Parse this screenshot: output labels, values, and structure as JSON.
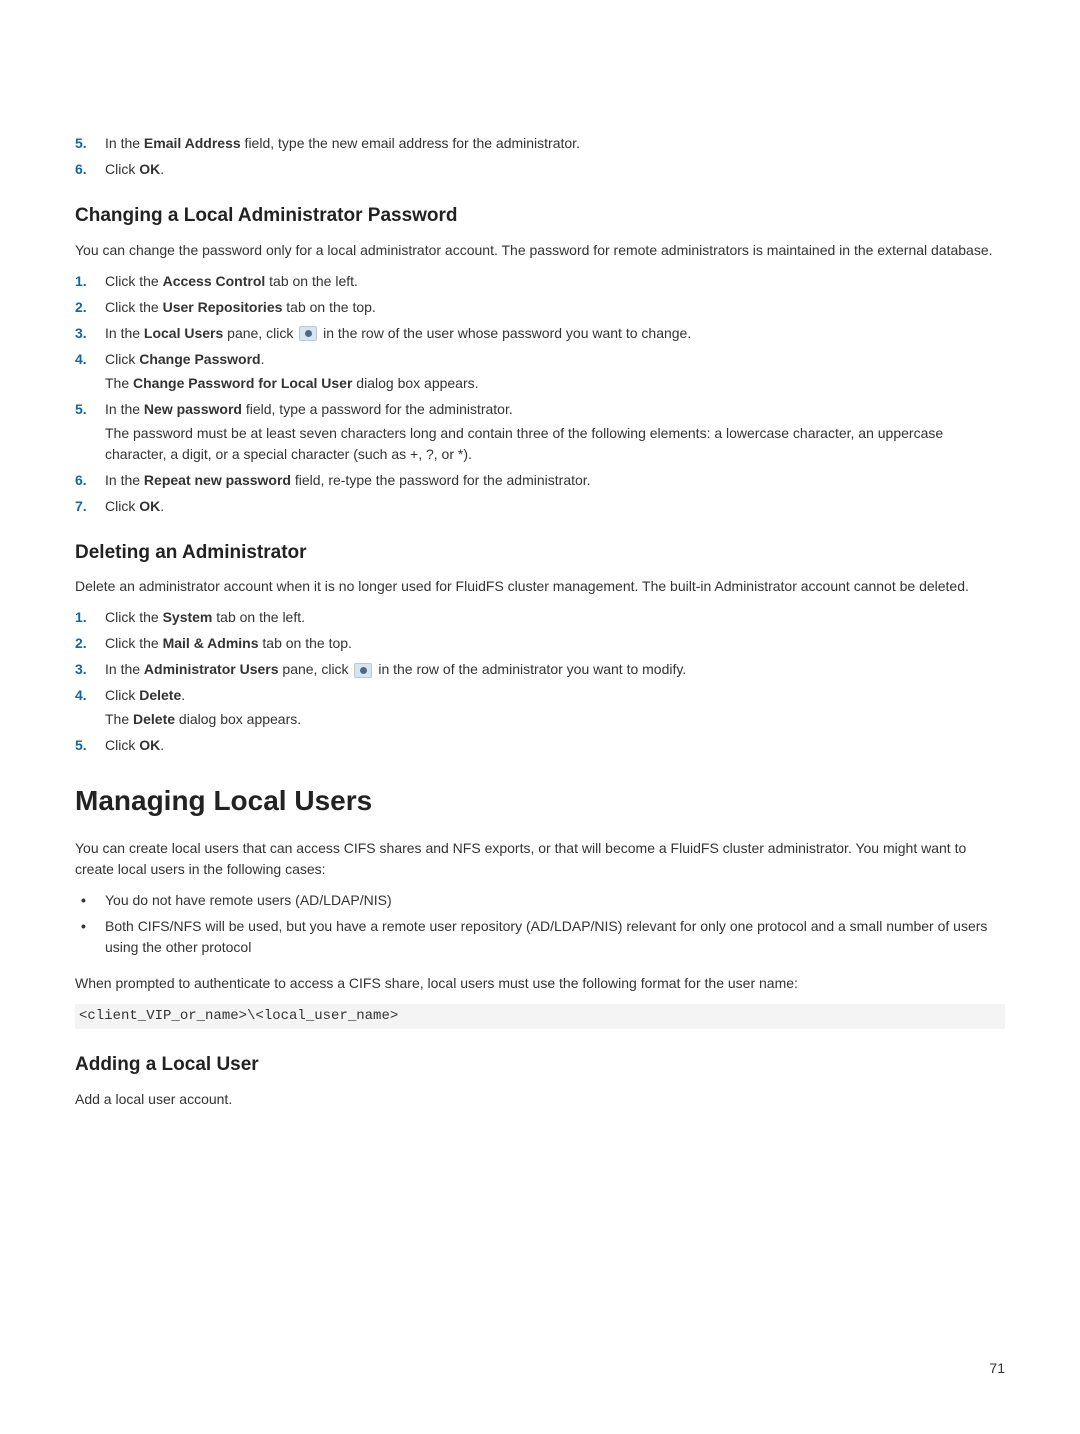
{
  "topSteps": {
    "s5": {
      "num": "5.",
      "pre": "In the ",
      "bold": "Email Address",
      "post": " field, type the new email address for the administrator."
    },
    "s6": {
      "num": "6.",
      "pre": "Click ",
      "bold": "OK",
      "post": "."
    }
  },
  "h_changing": "Changing a Local Administrator Password",
  "p_changing": "You can change the password only for a local administrator account. The password for remote administrators is maintained in the external database.",
  "chSteps": {
    "s1": {
      "num": "1.",
      "pre": "Click the ",
      "bold": "Access Control",
      "post": " tab on the left."
    },
    "s2": {
      "num": "2.",
      "pre": "Click the ",
      "bold": "User Repositories",
      "post": " tab on the top."
    },
    "s3": {
      "num": "3.",
      "pre": "In the ",
      "bold": "Local Users",
      "mid": " pane, click ",
      "post": " in the row of the user whose password you want to change."
    },
    "s4": {
      "num": "4.",
      "pre": "Click ",
      "bold": "Change Password",
      "post": ".",
      "sub_pre": "The ",
      "sub_bold": "Change Password for Local User",
      "sub_post": " dialog box appears."
    },
    "s5": {
      "num": "5.",
      "pre": "In the ",
      "bold": "New password",
      "post": " field, type a password for the administrator.",
      "sub": "The password must be at least seven characters long and contain three of the following elements: a lowercase character, an uppercase character, a digit, or a special character (such as +, ?, or *)."
    },
    "s6": {
      "num": "6.",
      "pre": "In the ",
      "bold": "Repeat new password",
      "post": " field, re‑type the password for the administrator."
    },
    "s7": {
      "num": "7.",
      "pre": "Click ",
      "bold": "OK",
      "post": "."
    }
  },
  "h_deleting": "Deleting an Administrator",
  "p_deleting": "Delete an administrator account when it is no longer used for FluidFS cluster management. The built‑in Administrator account cannot be deleted.",
  "delSteps": {
    "s1": {
      "num": "1.",
      "pre": "Click the ",
      "bold": "System",
      "post": " tab on the left."
    },
    "s2": {
      "num": "2.",
      "pre": "Click the ",
      "bold": "Mail & Admins",
      "post": " tab on the top."
    },
    "s3": {
      "num": "3.",
      "pre": "In the ",
      "bold": "Administrator Users",
      "mid": " pane, click ",
      "post": " in the row of the administrator you want to modify."
    },
    "s4": {
      "num": "4.",
      "pre": "Click ",
      "bold": "Delete",
      "post": ".",
      "sub_pre": "The ",
      "sub_bold": "Delete",
      "sub_post": " dialog box appears."
    },
    "s5": {
      "num": "5.",
      "pre": "Click ",
      "bold": "OK",
      "post": "."
    }
  },
  "h_managing": "Managing Local Users",
  "p_managing": "You can create local users that can access CIFS shares and NFS exports, or that will become a FluidFS cluster administrator. You might want to create local users in the following cases:",
  "bullets": {
    "b1": "You do not have remote users (AD/LDAP/NIS)",
    "b2": "Both CIFS/NFS will be used, but you have a remote user repository (AD/LDAP/NIS) relevant for only one protocol and a small number of users using the other protocol"
  },
  "p_prompt": "When prompted to authenticate to access a CIFS share, local users must use the following format for the user name:",
  "code": "<client_VIP_or_name>\\<local_user_name>",
  "h_adding": "Adding a Local User",
  "p_adding": "Add a local user account.",
  "pagenum": "71"
}
